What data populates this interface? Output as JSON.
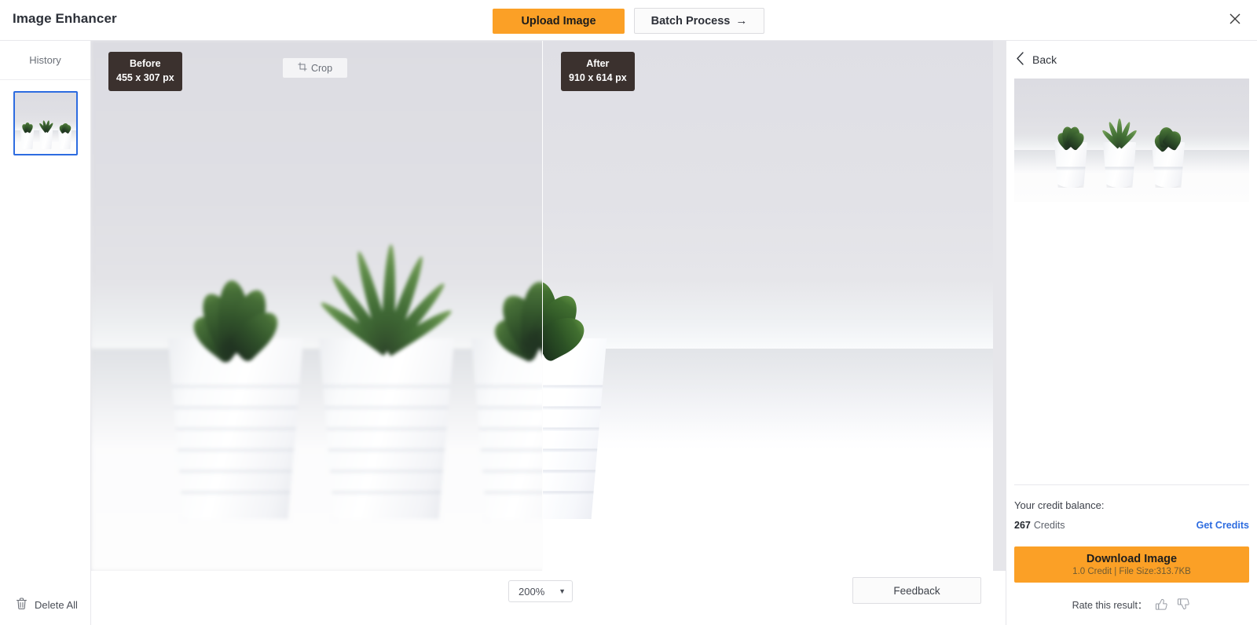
{
  "app": {
    "title": "Image Enhancer"
  },
  "topbar": {
    "upload_label": "Upload Image",
    "batch_label": "Batch Process",
    "batch_arrow": "→",
    "close_icon": "close-icon"
  },
  "sidebar": {
    "history_label": "History",
    "delete_all_label": "Delete All",
    "items": [
      {
        "name": "succulents-thumbnail",
        "selected": true
      }
    ]
  },
  "stage": {
    "before": {
      "title": "Before",
      "dimensions": "455 x 307 px"
    },
    "after": {
      "title": "After",
      "dimensions": "910 x 614 px"
    },
    "crop_label": "Crop",
    "zoom_value": "200%",
    "feedback_label": "Feedback"
  },
  "panel": {
    "back_label": "Back",
    "credit_title": "Your credit balance:",
    "credit_amount": "267",
    "credit_unit": "Credits",
    "get_credits_label": "Get Credits",
    "download_label": "Download Image",
    "download_meta": "1.0 Credit | File Size:313.7KB",
    "rate_label": "Rate this result："
  },
  "colors": {
    "accent": "#fba026",
    "link": "#2d6ce0",
    "badge_bg": "#3b312e",
    "canvas_bg": "#e6e6ea"
  }
}
